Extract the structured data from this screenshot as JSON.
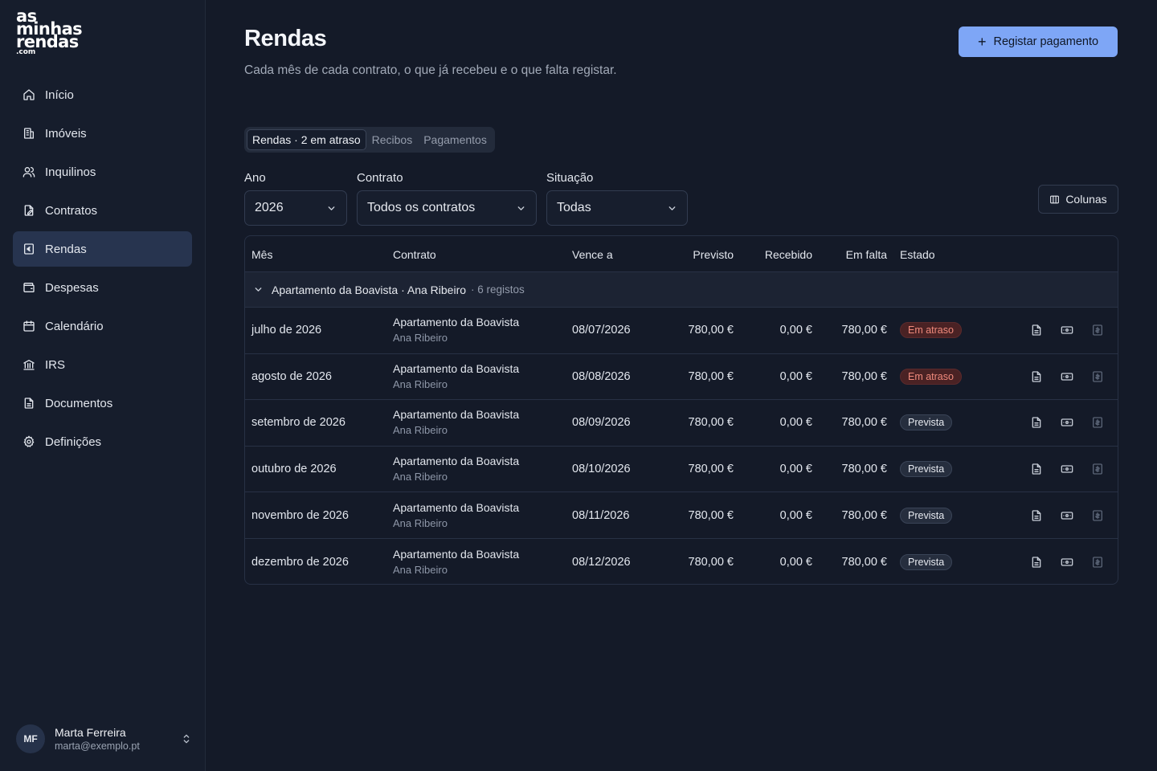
{
  "app": {
    "logo_lines": [
      "as",
      "minhas",
      "rendas"
    ],
    "logo_suffix": ".com"
  },
  "sidebar": {
    "items": [
      {
        "label": "Início",
        "icon": "home-icon"
      },
      {
        "label": "Imóveis",
        "icon": "building-icon"
      },
      {
        "label": "Inquilinos",
        "icon": "users-icon"
      },
      {
        "label": "Contratos",
        "icon": "contract-icon"
      },
      {
        "label": "Rendas",
        "icon": "receipt-icon",
        "active": true
      },
      {
        "label": "Despesas",
        "icon": "wallet-icon"
      },
      {
        "label": "Calendário",
        "icon": "calendar-icon"
      },
      {
        "label": "IRS",
        "icon": "bank-icon"
      },
      {
        "label": "Documentos",
        "icon": "document-icon"
      },
      {
        "label": "Definições",
        "icon": "gear-icon"
      }
    ]
  },
  "user": {
    "initials": "MF",
    "name": "Marta Ferreira",
    "email": "marta@exemplo.pt"
  },
  "header": {
    "title": "Rendas",
    "subtitle": "Cada mês de cada contrato, o que já recebeu e o que falta registar.",
    "primary_action": "Registar pagamento"
  },
  "tabs": [
    {
      "label": "Rendas · 2 em atraso",
      "active": true
    },
    {
      "label": "Recibos"
    },
    {
      "label": "Pagamentos"
    }
  ],
  "filters": {
    "year": {
      "label": "Ano",
      "value": "2026"
    },
    "contract": {
      "label": "Contrato",
      "value": "Todos os contratos"
    },
    "status": {
      "label": "Situação",
      "value": "Todas"
    }
  },
  "columns_button": "Colunas",
  "table": {
    "headers": {
      "month": "Mês",
      "contract": "Contrato",
      "due": "Vence a",
      "expected": "Previsto",
      "received": "Recebido",
      "missing": "Em falta",
      "status": "Estado"
    },
    "group": {
      "title": "Apartamento da Boavista · Ana Ribeiro",
      "count": "· 6 registos"
    },
    "rows": [
      {
        "month": "julho de 2026",
        "contract": "Apartamento da Boavista",
        "tenant": "Ana Ribeiro",
        "due": "08/07/2026",
        "expected": "780,00 €",
        "received": "0,00 €",
        "missing": "780,00 €",
        "status": "Em atraso",
        "status_kind": "late"
      },
      {
        "month": "agosto de 2026",
        "contract": "Apartamento da Boavista",
        "tenant": "Ana Ribeiro",
        "due": "08/08/2026",
        "expected": "780,00 €",
        "received": "0,00 €",
        "missing": "780,00 €",
        "status": "Em atraso",
        "status_kind": "late"
      },
      {
        "month": "setembro de 2026",
        "contract": "Apartamento da Boavista",
        "tenant": "Ana Ribeiro",
        "due": "08/09/2026",
        "expected": "780,00 €",
        "received": "0,00 €",
        "missing": "780,00 €",
        "status": "Prevista",
        "status_kind": "planned"
      },
      {
        "month": "outubro de 2026",
        "contract": "Apartamento da Boavista",
        "tenant": "Ana Ribeiro",
        "due": "08/10/2026",
        "expected": "780,00 €",
        "received": "0,00 €",
        "missing": "780,00 €",
        "status": "Prevista",
        "status_kind": "planned"
      },
      {
        "month": "novembro de 2026",
        "contract": "Apartamento da Boavista",
        "tenant": "Ana Ribeiro",
        "due": "08/11/2026",
        "expected": "780,00 €",
        "received": "0,00 €",
        "missing": "780,00 €",
        "status": "Prevista",
        "status_kind": "planned"
      },
      {
        "month": "dezembro de 2026",
        "contract": "Apartamento da Boavista",
        "tenant": "Ana Ribeiro",
        "due": "08/12/2026",
        "expected": "780,00 €",
        "received": "0,00 €",
        "missing": "780,00 €",
        "status": "Prevista",
        "status_kind": "planned"
      }
    ]
  },
  "colors": {
    "background": "#141a28",
    "sidebar": "#161d2c",
    "accent": "#7ea6f6",
    "late_text": "#f08a7c",
    "late_bg": "#4a2224"
  }
}
